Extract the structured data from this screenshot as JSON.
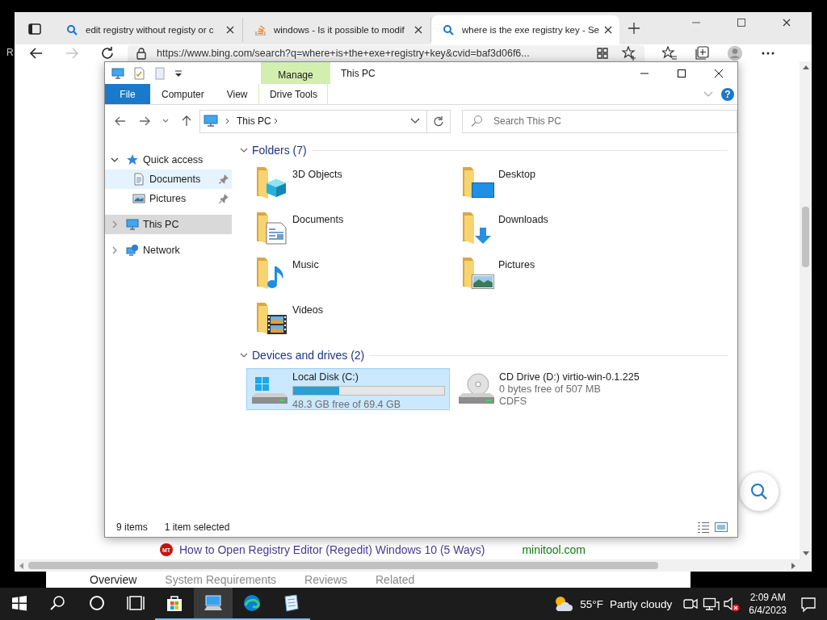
{
  "desktop": {
    "edge_text": "R"
  },
  "browser": {
    "tabs": [
      {
        "title": "edit registry without registy or c",
        "kind": "search",
        "selected": false
      },
      {
        "title": "windows - Is it possible to modif",
        "kind": "stack",
        "selected": false
      },
      {
        "title": "where is the exe registry key - Se",
        "kind": "search",
        "selected": true
      }
    ],
    "forward_disabled": true,
    "url": "https://www.bing.com/search?q=where+is+the+exe+registry+key&cvid=baf3d06f6...",
    "result": {
      "badge": "MT",
      "title": "How to Open Registry Editor (Regedit) Windows 10 (5 Ways)",
      "site": "minitool.com"
    }
  },
  "store_window": {
    "tabs": [
      {
        "label": "Overview",
        "selected": true
      },
      {
        "label": "System Requirements",
        "selected": false
      },
      {
        "label": "Reviews",
        "selected": false
      },
      {
        "label": "Related",
        "selected": false
      }
    ]
  },
  "explorer": {
    "title": "This PC",
    "contextual_label": "Manage",
    "help_label": "?",
    "ribbon_tabs": [
      {
        "label": "File",
        "kind": "file",
        "selected": false
      },
      {
        "label": "Computer",
        "kind": "plain",
        "selected": false
      },
      {
        "label": "View",
        "kind": "plain",
        "selected": false
      },
      {
        "label": "Drive Tools",
        "kind": "contextual",
        "selected": false
      }
    ],
    "address": "This PC",
    "search_placeholder": "Search This PC",
    "tree": [
      {
        "label": "Quick access",
        "kind": "star",
        "expanded": true,
        "selected": false,
        "hovered": false,
        "children": [
          {
            "label": "Documents",
            "kind": "document",
            "pinned": true,
            "selected": false,
            "hovered": true
          },
          {
            "label": "Pictures",
            "kind": "picture",
            "pinned": true,
            "selected": false,
            "hovered": false
          }
        ]
      },
      {
        "label": "This PC",
        "kind": "computer",
        "expanded": false,
        "selected": true,
        "hovered": false
      },
      {
        "label": "Network",
        "kind": "network",
        "expanded": false,
        "selected": false,
        "hovered": false
      }
    ],
    "groups": [
      {
        "title": "Folders (7)",
        "kind": "folders",
        "expanded": true,
        "items": [
          {
            "name": "3D Objects",
            "kind": "cube"
          },
          {
            "name": "Desktop",
            "kind": "desktop"
          },
          {
            "name": "Documents",
            "kind": "document"
          },
          {
            "name": "Downloads",
            "kind": "download"
          },
          {
            "name": "Music",
            "kind": "music"
          },
          {
            "name": "Pictures",
            "kind": "picture"
          },
          {
            "name": "Videos",
            "kind": "video"
          }
        ]
      },
      {
        "title": "Devices and drives (2)",
        "kind": "drives",
        "expanded": true,
        "items": [
          {
            "name": "Local Disk (C:)",
            "kind": "system-drive",
            "selected": true,
            "level": 0.304,
            "details": [
              "48.3 GB free of 69.4 GB"
            ]
          },
          {
            "name": "CD Drive (D:) virtio-win-0.1.225",
            "kind": "cd-drive",
            "selected": false,
            "details": [
              "0 bytes free of 507 MB",
              "CDFS"
            ]
          }
        ]
      }
    ],
    "status": {
      "count": "9 items",
      "selection": "1 item selected"
    }
  },
  "taskbar": {
    "apps": [
      {
        "kind": "search",
        "open": false,
        "active": false
      },
      {
        "kind": "cortana",
        "open": false,
        "active": false
      },
      {
        "kind": "task-view",
        "open": false,
        "active": false
      },
      {
        "kind": "store",
        "open": true,
        "active": false
      },
      {
        "kind": "explorer",
        "open": true,
        "active": true
      },
      {
        "kind": "edge",
        "open": true,
        "active": false
      },
      {
        "kind": "notepad",
        "open": true,
        "active": false
      }
    ],
    "weather": {
      "temperature": "55°F",
      "condition": "Partly cloudy"
    },
    "volume_muted": true,
    "time": "2:09 AM",
    "date": "6/4/2023"
  }
}
